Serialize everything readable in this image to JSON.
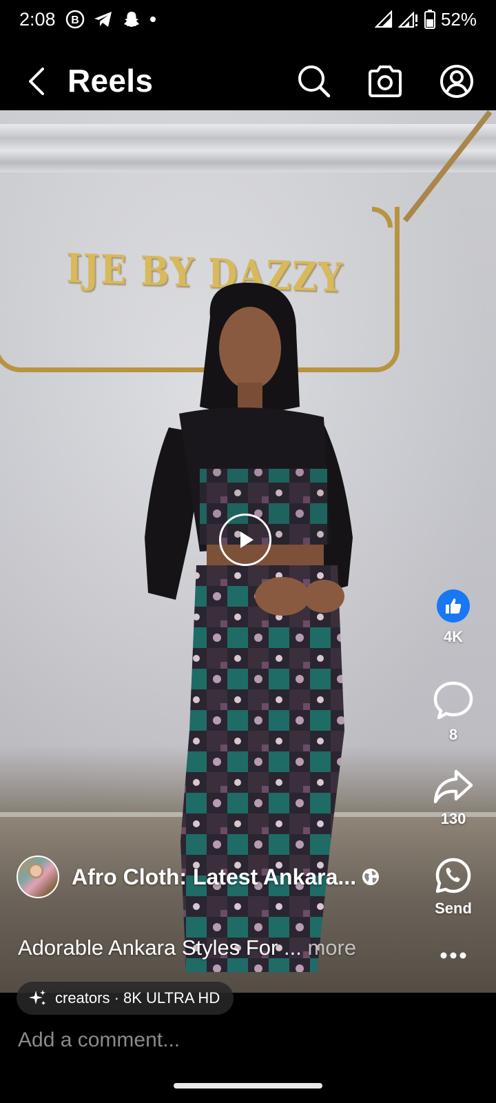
{
  "status_bar": {
    "time": "2:08",
    "battery": "52%",
    "left_icons": [
      "b-icon",
      "telegram-icon",
      "snapchat-icon",
      "dot-icon"
    ],
    "right_icons": [
      "signal-icon",
      "signal-alert-icon",
      "battery-icon"
    ]
  },
  "header": {
    "title": "Reels",
    "icons": [
      "back-arrow-icon",
      "search-icon",
      "camera-icon",
      "profile-icon"
    ]
  },
  "video": {
    "wall_sign": "IJE BY DAZZY",
    "playback_icon": "play-icon"
  },
  "actions": {
    "like_count": "4K",
    "comment_count": "8",
    "share_count": "130",
    "send_label": "Send",
    "like_color": "#1877f2"
  },
  "post": {
    "author": "Afro Cloth: Latest Ankara...",
    "caption": "Adorable Ankara Styles For ...",
    "more_label": "more",
    "chip_text": "creators · 8K ULTRA HD"
  },
  "comment": {
    "placeholder": "Add a comment..."
  }
}
